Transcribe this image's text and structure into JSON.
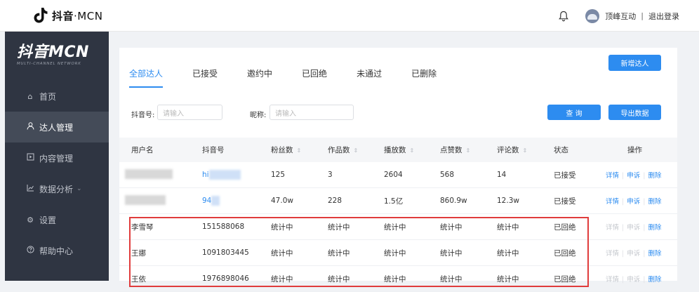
{
  "header": {
    "brand_name": "抖音",
    "brand_suffix": "·MCN",
    "company": "顶峰互动",
    "divider": "|",
    "logout": "退出登录"
  },
  "sidebar": {
    "logo_title": "抖音MCN",
    "logo_subtitle": "MULTI-CHANNEL NETWORK",
    "items": [
      {
        "label": "首页",
        "icon": "home-icon",
        "active": false
      },
      {
        "label": "达人管理",
        "icon": "user-icon",
        "active": true
      },
      {
        "label": "内容管理",
        "icon": "content-icon",
        "active": false
      },
      {
        "label": "数据分析",
        "icon": "chart-icon",
        "active": false,
        "caret": "⌄"
      },
      {
        "label": "设置",
        "icon": "gear-icon",
        "active": false
      },
      {
        "label": "帮助中心",
        "icon": "help-icon",
        "active": false
      }
    ]
  },
  "main": {
    "add_button": "新增达人",
    "tabs": [
      "全部达人",
      "已接受",
      "邀约中",
      "已回绝",
      "未通过",
      "已删除"
    ],
    "filters": {
      "douyin_label": "抖音号:",
      "douyin_placeholder": "请输入",
      "nickname_label": "昵称:",
      "nickname_placeholder": "请输入"
    },
    "query_button": "查 询",
    "export_button": "导出数据",
    "table": {
      "headers": [
        "用户名",
        "抖音号",
        "粉丝数",
        "作品数",
        "播放数",
        "点赞数",
        "评论数",
        "状态",
        "操作"
      ],
      "rows": [
        {
          "username": "",
          "douyin": "hi",
          "fans": "125",
          "works": "3",
          "plays": "2604",
          "likes": "568",
          "comments": "14",
          "status": "已接受",
          "op1": "详情",
          "op2": "申诉",
          "op3": "删除",
          "blurred": true
        },
        {
          "username": "",
          "douyin": "94",
          "fans": "47.0w",
          "works": "228",
          "plays": "1.5亿",
          "likes": "860.9w",
          "comments": "12.3w",
          "status": "已接受",
          "op1": "详情",
          "op2": "申诉",
          "op3": "删除",
          "blurred": true
        },
        {
          "username": "李雪琴",
          "douyin": "151588068",
          "fans": "统计中",
          "works": "统计中",
          "plays": "统计中",
          "likes": "统计中",
          "comments": "统计中",
          "status": "已回绝",
          "op1": "详情",
          "op2": "申诉",
          "op3": "删除",
          "blurred": false
        },
        {
          "username": "王娜",
          "douyin": "1091803445",
          "fans": "统计中",
          "works": "统计中",
          "plays": "统计中",
          "likes": "统计中",
          "comments": "统计中",
          "status": "已回绝",
          "op1": "详情",
          "op2": "申诉",
          "op3": "删除",
          "blurred": false
        },
        {
          "username": "王依",
          "douyin": "1976898046",
          "fans": "统计中",
          "works": "统计中",
          "plays": "统计中",
          "likes": "统计中",
          "comments": "统计中",
          "status": "已回绝",
          "op1": "详情",
          "op2": "申诉",
          "op3": "删除",
          "blurred": false
        }
      ]
    }
  },
  "colors": {
    "accent": "#2d8cf0",
    "sidebar_bg": "#2f3542",
    "highlight_box": "#e03c3c"
  }
}
